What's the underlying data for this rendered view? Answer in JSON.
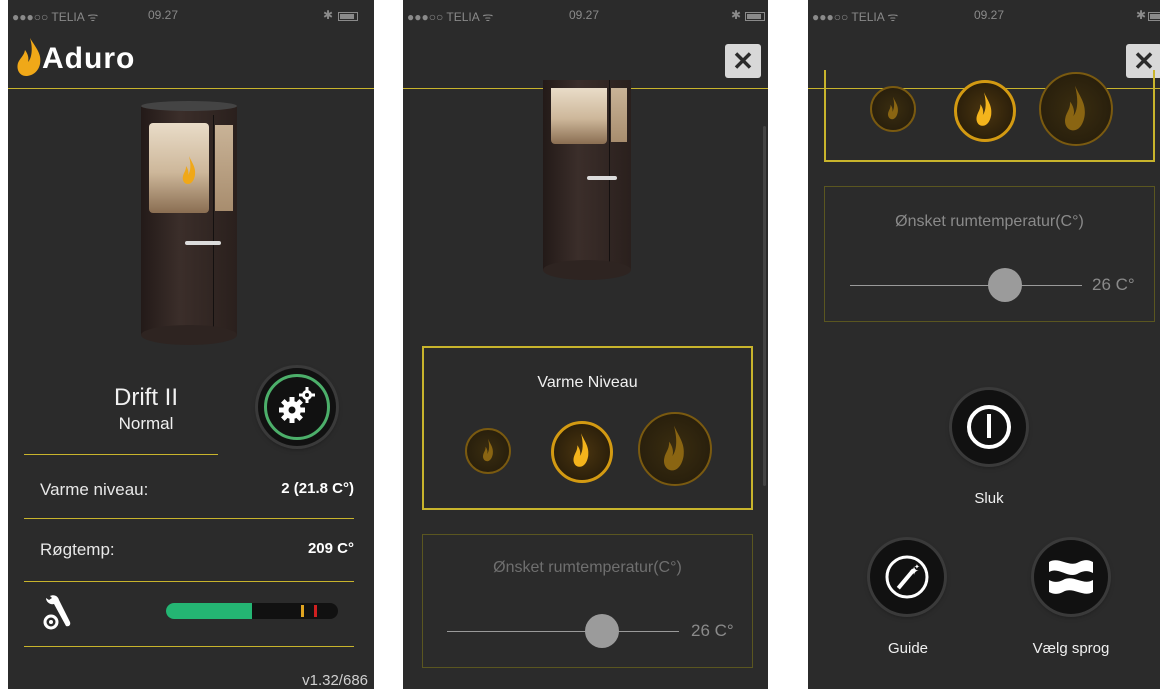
{
  "status": {
    "carrier": "●●●○○ TELIA ᯤ",
    "time": "09.27",
    "bluetooth": "✱"
  },
  "screen1": {
    "logo_text": "Aduro",
    "mode_title": "Drift II",
    "mode_sub": "Normal",
    "rows": [
      {
        "label": "Varme niveau:",
        "value": "2 (21.8 C°)"
      },
      {
        "label": "Røgtemp:",
        "value": "209 C°"
      }
    ],
    "progress": {
      "fill_fraction": 0.5,
      "marker_colors": [
        "#e0a420",
        "#d02020"
      ]
    },
    "version": "v1.32/686"
  },
  "screen2": {
    "close_label": "✕",
    "heat_title": "Varme Niveau",
    "levels": [
      "level-1",
      "level-2",
      "level-3"
    ],
    "selected_level": 2,
    "temp_title": "Ønsket rumtemperatur(C°)",
    "temp_value": "26 C°"
  },
  "screen3": {
    "close_label": "✕",
    "temp_title": "Ønsket rumtemperatur(C°)",
    "temp_value": "26 C°",
    "power_label": "Sluk",
    "guide_label": "Guide",
    "language_label": "Vælg sprog"
  },
  "colors": {
    "accent": "#c8b42c",
    "flame": "#f0b020",
    "green": "#24b573"
  }
}
